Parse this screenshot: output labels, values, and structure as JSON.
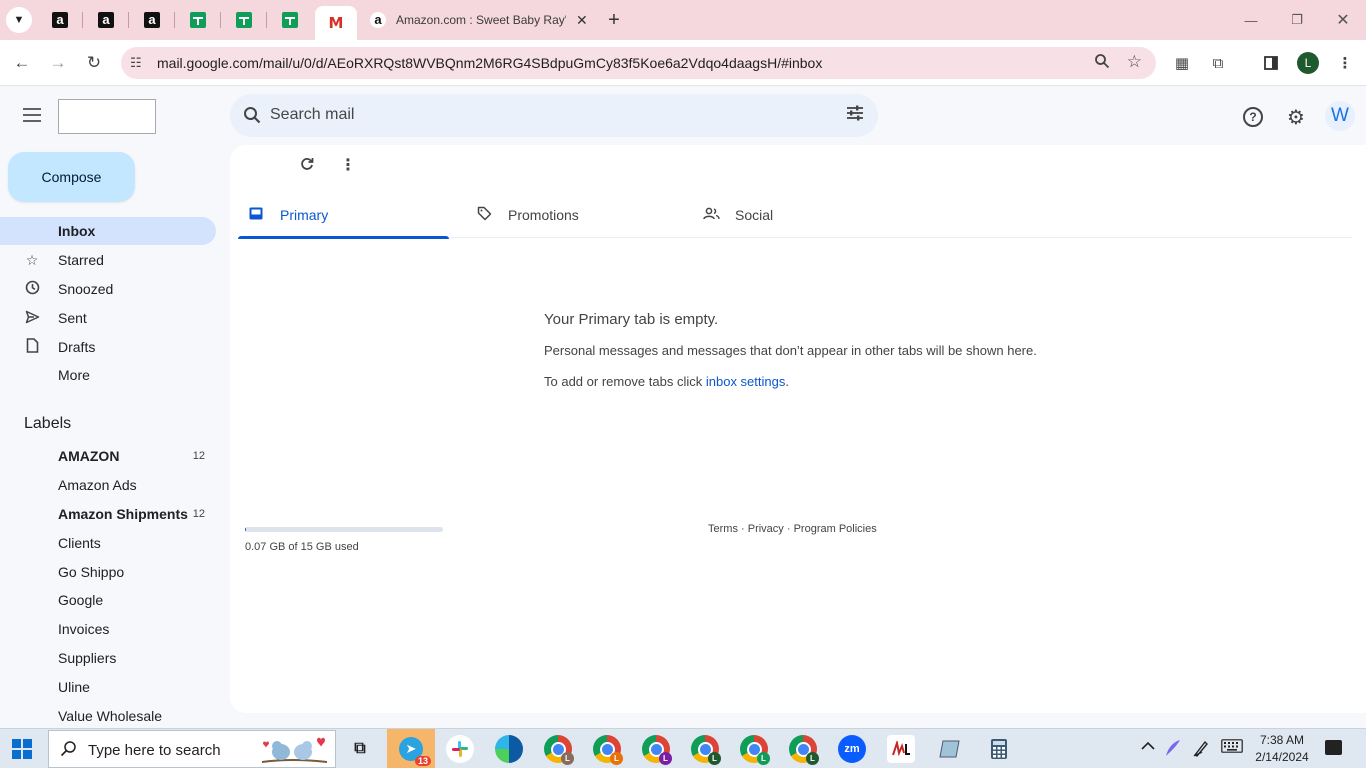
{
  "browser": {
    "active_tab_title": "Amazon.com : Sweet Baby Ray's",
    "url": "mail.google.com/mail/u/0/d/AEoRXRQst8WVBQnm2M6RG4SBdpuGmCy83f5Koe6a2Vdqo4daagsH/#inbox",
    "profile_initial": "L"
  },
  "gmail": {
    "search_placeholder": "Search mail",
    "avatar_initial": "W",
    "compose_label": "Compose",
    "nav": [
      {
        "label": "Inbox",
        "icon": "inbox-icon"
      },
      {
        "label": "Starred",
        "icon": "star-icon"
      },
      {
        "label": "Snoozed",
        "icon": "clock-icon"
      },
      {
        "label": "Sent",
        "icon": "send-icon"
      },
      {
        "label": "Drafts",
        "icon": "draft-icon"
      },
      {
        "label": "More",
        "icon": "chevron-down-icon"
      }
    ],
    "labels_heading": "Labels",
    "labels": [
      {
        "label": "AMAZON",
        "count": "12",
        "bold": true
      },
      {
        "label": "Amazon Ads",
        "count": "",
        "bold": false
      },
      {
        "label": "Amazon Shipments",
        "count": "12",
        "bold": true
      },
      {
        "label": "Clients",
        "count": "",
        "bold": false
      },
      {
        "label": "Go Shippo",
        "count": "",
        "bold": false
      },
      {
        "label": "Google",
        "count": "",
        "bold": false
      },
      {
        "label": "Invoices",
        "count": "",
        "bold": false
      },
      {
        "label": "Suppliers",
        "count": "",
        "bold": false
      },
      {
        "label": "Uline",
        "count": "",
        "bold": false
      },
      {
        "label": "Value Wholesale",
        "count": "",
        "bold": false
      }
    ],
    "tabs": [
      {
        "label": "Primary",
        "active": true
      },
      {
        "label": "Promotions",
        "active": false
      },
      {
        "label": "Social",
        "active": false
      }
    ],
    "empty": {
      "title": "Your Primary tab is empty.",
      "description": "Personal messages and messages that don’t appear in other tabs will be shown here.",
      "hint_prefix": "To add or remove tabs click ",
      "hint_link": "inbox settings",
      "hint_suffix": "."
    },
    "storage": {
      "text": "0.07 GB of 15 GB used",
      "fraction": 0.005
    },
    "footer": {
      "terms": "Terms",
      "privacy": "Privacy",
      "policies": "Program Policies",
      "separator": " · "
    }
  },
  "taskbar": {
    "search_placeholder": "Type here to search",
    "telegram_badge": "13",
    "zoom_label": "zm",
    "time": "7:38 AM",
    "date": "2/14/2024"
  },
  "colors": {
    "accent": "#0b57d0",
    "compose_bg": "#c2e7ff",
    "active_nav": "#d3e3fd",
    "tab_strip": "#f5d7de"
  }
}
